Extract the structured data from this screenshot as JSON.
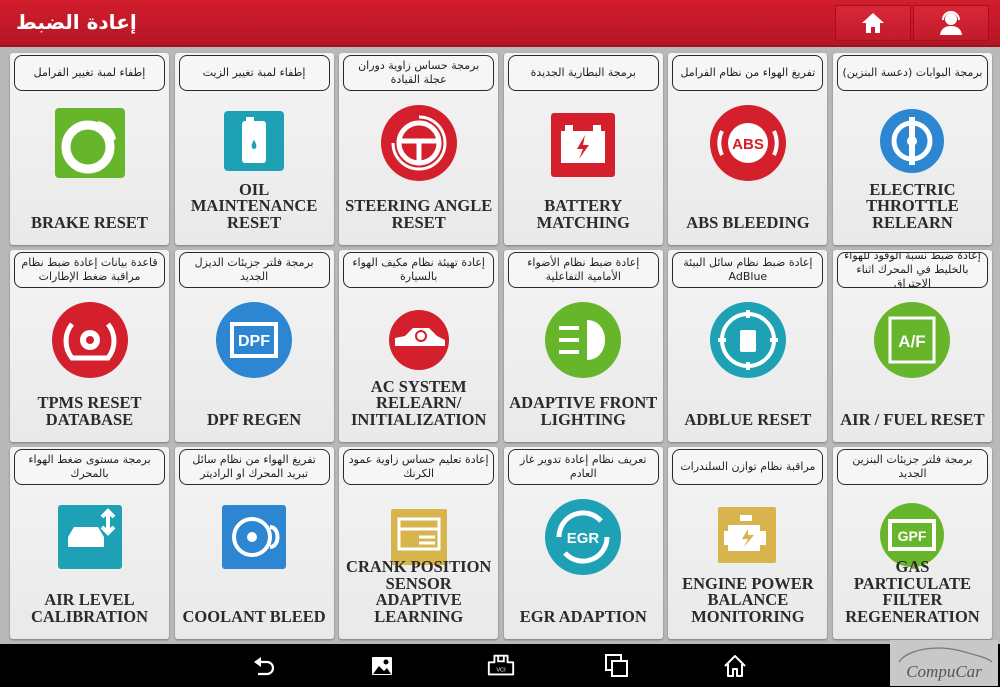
{
  "header": {
    "title": "إعادة الضبط",
    "home_button": "home-icon",
    "support_button": "headset-support-icon"
  },
  "colors": {
    "header_red": "#c81a2a",
    "red": "#d3202c",
    "green": "#67b52a",
    "teal": "#1ea1b5",
    "blue": "#2d86d1",
    "gold": "#d8b44c"
  },
  "cards": [
    {
      "ar": "إطفاء لمبة تغيير الفرامل",
      "en": "BRAKE RESET",
      "icon": "brake-disc-icon"
    },
    {
      "ar": "إطفاء لمبة تغيير الزيت",
      "en": "OIL\nMAINTENANCE\nRESET",
      "icon": "oil-can-icon"
    },
    {
      "ar": "برمجة حساس زاوية دوران عجلة القيادة",
      "en": "STEERING ANGLE\nRESET",
      "icon": "steering-wheel-icon"
    },
    {
      "ar": "برمجة البطارية الجديدة",
      "en": "BATTERY\nMATCHING",
      "icon": "battery-icon"
    },
    {
      "ar": "تفريغ الهواء من نظام الفرامل",
      "en": "ABS BLEEDING",
      "icon": "abs-icon"
    },
    {
      "ar": "برمجة البوابات (دعسة البنزين)",
      "en": "ELECTRIC\nTHROTTLE\nRELEARN",
      "icon": "throttle-icon"
    },
    {
      "ar": "قاعدة بيانات إعادة ضبط نظام مراقبة ضغط الإطارات",
      "en": "TPMS RESET\nDATABASE",
      "icon": "tpms-icon"
    },
    {
      "ar": "برمجة فلتر جزيئات الديزل الجديد",
      "en": "DPF REGEN",
      "icon": "dpf-icon"
    },
    {
      "ar": "إعادة تهيئة نظام مكيف الهواء بالسيارة",
      "en": "AC SYSTEM\nRELEARN/\nINITIALIZATION",
      "icon": "car-ac-icon"
    },
    {
      "ar": "إعادة ضبط نظام الأضواء الأمامية التفاعلية",
      "en": "ADAPTIVE FRONT\nLIGHTING",
      "icon": "headlight-icon"
    },
    {
      "ar": "إعادة ضبط نظام سائل البيئة AdBlue",
      "en": "ADBLUE RESET",
      "icon": "adblue-icon"
    },
    {
      "ar": "إعادة ضبط نسبة الوقود للهواء بالخليط في المحرك اثناء الاحتراق",
      "en": "AIR / FUEL RESET",
      "icon": "air-fuel-icon"
    },
    {
      "ar": "برمجة مستوى ضغط الهواء بالمحرك",
      "en": "AIR LEVEL\nCALIBRATION",
      "icon": "car-level-icon"
    },
    {
      "ar": "تفريغ الهواء من نظام سائل تبريد المحرك او الراديتر",
      "en": "COOLANT BLEED",
      "icon": "coolant-pump-icon"
    },
    {
      "ar": "إعادة تعليم حساس زاوية عمود الكرنك",
      "en": "CRANK POSITION\nSENSOR ADAPTIVE\nLEARNING",
      "icon": "crank-sensor-icon"
    },
    {
      "ar": "تعريف نظام إعادة تدوير غاز العادم",
      "en": "EGR ADAPTION",
      "icon": "egr-icon"
    },
    {
      "ar": "مراقبة نظام توازن السلندرات",
      "en": "ENGINE POWER\nBALANCE\nMONITORING",
      "icon": "engine-icon"
    },
    {
      "ar": "برمجة فلتر جزيئات البنزين الجديد",
      "en": "GAS PARTICULATE\nFILTER\nREGENERATION",
      "icon": "gpf-icon"
    }
  ],
  "navbar": {
    "items": [
      "back-icon",
      "screenshot-icon",
      "vci-icon",
      "recent-apps-icon",
      "home-icon"
    ],
    "vci_label": "VCI"
  },
  "watermark": {
    "text": "CompuCar"
  }
}
